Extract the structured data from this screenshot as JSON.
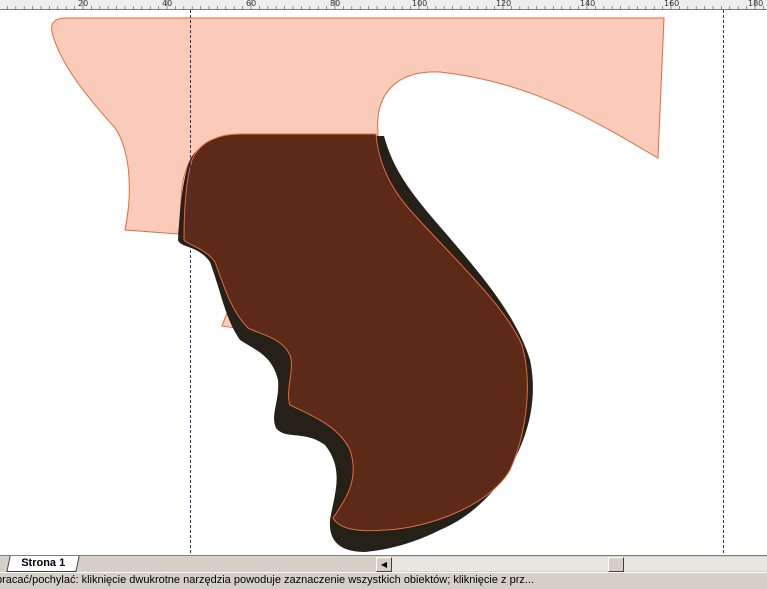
{
  "ruler": {
    "labels": [
      "20",
      "40",
      "60",
      "80",
      "100",
      "120",
      "140",
      "160",
      "180"
    ]
  },
  "colors": {
    "ruler_bg": "#eeeeee",
    "shape_light_fill": "#f9cbb8",
    "shape_light_stroke": "#e46a3e",
    "shape_dark_fill": "#5e2a18",
    "shape_shadow_fill": "#252119",
    "guide_line": "#333366",
    "toolbar_bg": "#d4d0c8"
  },
  "page_tabs": {
    "active_label": "Strona 1"
  },
  "status": {
    "text": "pracać/pochylać: kliknięcie dwukrotne narzędzia powoduje zaznaczenie wszystkich obiektów; kliknięcie z prz..."
  },
  "icons": {
    "scroll_left": "arrow-left-icon"
  }
}
